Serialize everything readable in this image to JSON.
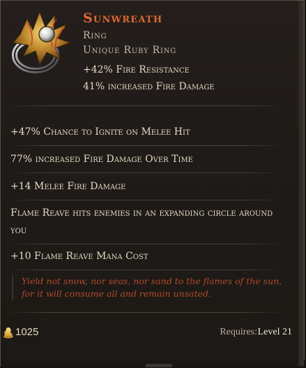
{
  "item": {
    "name": "Sunwreath",
    "type": "Ring",
    "rarity": "Unique Ruby Ring",
    "icon": "ornate-gold-ring-icon"
  },
  "implicits": [
    "+42% Fire Resistance",
    "41% increased Fire Damage"
  ],
  "affixes": [
    "+47% Chance to Ignite on Melee Hit",
    "77% increased Fire Damage Over Time",
    "+14 Melee Fire Damage",
    "Flame Reave hits enemies in an expanding circle around you",
    "+10 Flame Reave Mana Cost"
  ],
  "lore": "Yield not snow, nor seas, nor sand to the flames of the sun, for it will consume all and remain unsated.",
  "footer": {
    "gold_icon": "gold-coins-icon",
    "gold_value": "1025",
    "requires_label": "Requires:",
    "requires_value": "Level 21"
  },
  "colors": {
    "unique_name": "#e0672c",
    "lore": "#b24a28",
    "text": "#e3d8c6",
    "background": "#1f1b18"
  }
}
